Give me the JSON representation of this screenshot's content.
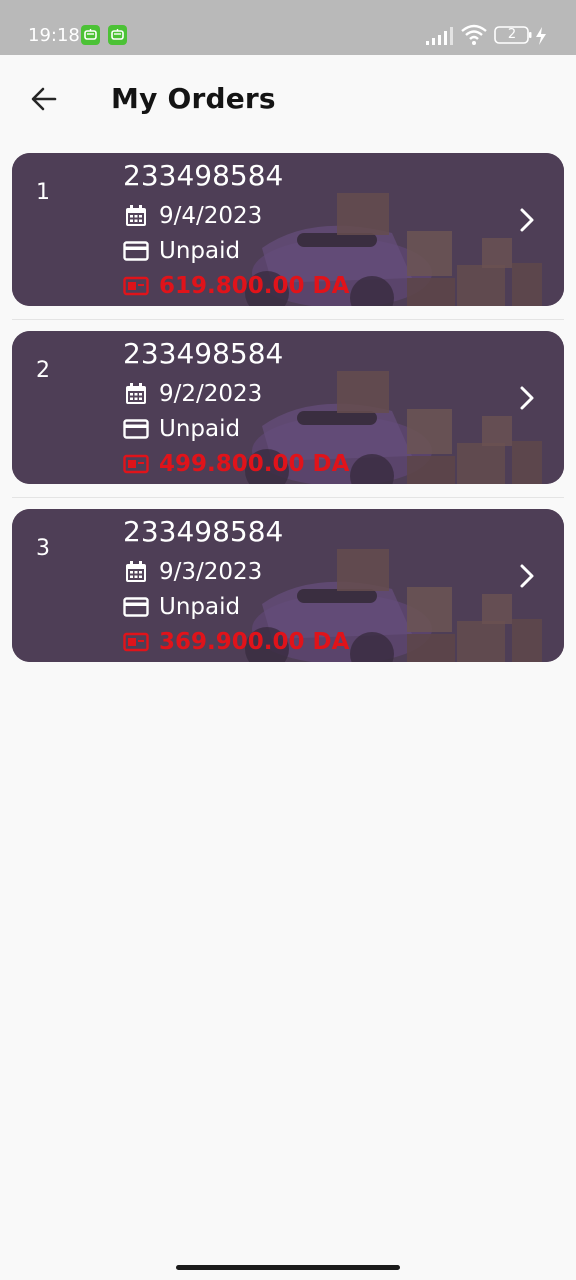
{
  "status_bar": {
    "time": "19:18",
    "battery_level": "2",
    "icons": [
      "app-notification-icon",
      "app-notification-icon",
      "signal-icon",
      "wifi-icon",
      "battery-icon",
      "charging-icon"
    ]
  },
  "header": {
    "back_icon": "arrow-left-icon",
    "title": "My Orders"
  },
  "orders": [
    {
      "index": "1",
      "number": "233498584",
      "date": "9/4/2023",
      "payment_status": "Unpaid",
      "amount": "619.800.00 DA"
    },
    {
      "index": "2",
      "number": "233498584",
      "date": "9/2/2023",
      "payment_status": "Unpaid",
      "amount": "499.800.00 DA"
    },
    {
      "index": "3",
      "number": "233498584",
      "date": "9/3/2023",
      "payment_status": "Unpaid",
      "amount": "369.900.00 DA"
    }
  ],
  "colors": {
    "amount": "#e0131a",
    "card_bg": "#56465a",
    "status_bar": "#b9b9b9",
    "app_icon": "#4cc236"
  }
}
